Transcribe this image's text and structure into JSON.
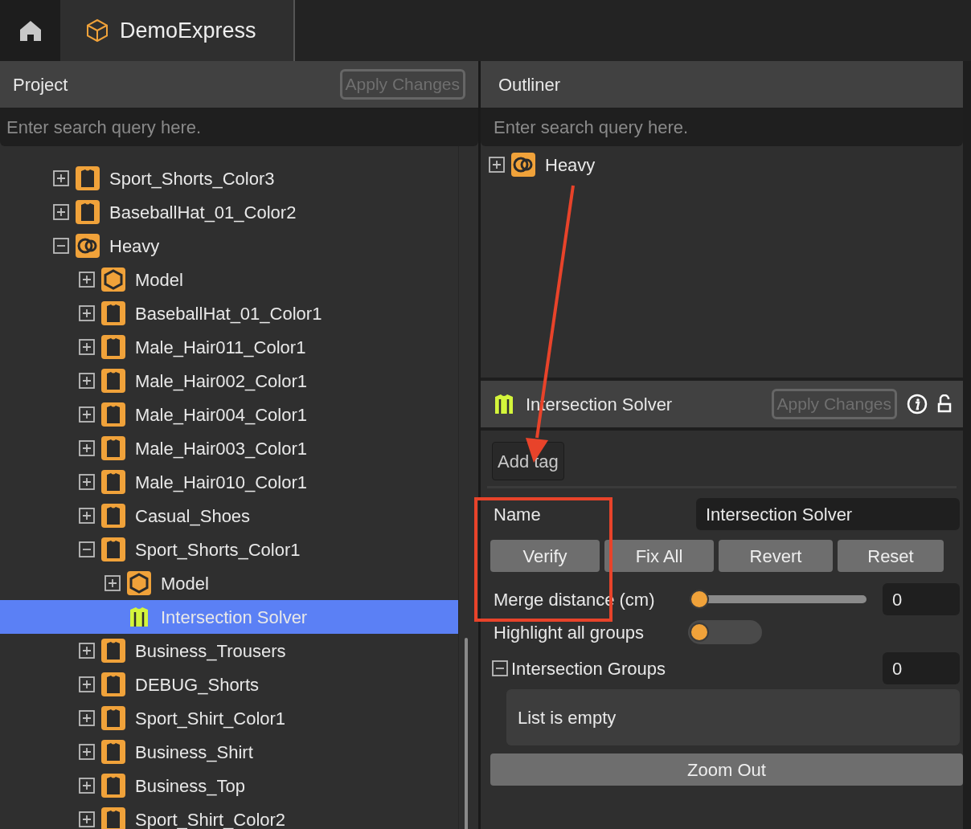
{
  "top_bar": {
    "tab": {
      "label": "DemoExpress",
      "selected": true
    }
  },
  "project": {
    "title": "Project",
    "apply_button": {
      "label": "Apply Changes",
      "disabled": true
    },
    "search": {
      "placeholder": "Enter search query here."
    },
    "tree": [
      {
        "label": "Sport_Shorts_Color3",
        "kind": "garment",
        "expanded": false,
        "selected": false
      },
      {
        "label": "BaseballHat_01_Color2",
        "kind": "garment",
        "expanded": false,
        "selected": false
      },
      {
        "label": "Heavy",
        "kind": "group",
        "expanded": true,
        "selected": false,
        "children": [
          {
            "label": "Model",
            "kind": "model",
            "expanded": false,
            "selected": false
          },
          {
            "label": "BaseballHat_01_Color1",
            "kind": "garment",
            "expanded": false,
            "selected": false
          },
          {
            "label": "Male_Hair011_Color1",
            "kind": "garment",
            "expanded": false,
            "selected": false
          },
          {
            "label": "Male_Hair002_Color1",
            "kind": "garment",
            "expanded": false,
            "selected": false
          },
          {
            "label": "Male_Hair004_Color1",
            "kind": "garment",
            "expanded": false,
            "selected": false
          },
          {
            "label": "Male_Hair003_Color1",
            "kind": "garment",
            "expanded": false,
            "selected": false
          },
          {
            "label": "Male_Hair010_Color1",
            "kind": "garment",
            "expanded": false,
            "selected": false
          },
          {
            "label": "Casual_Shoes",
            "kind": "garment",
            "expanded": false,
            "selected": false
          },
          {
            "label": "Sport_Shorts_Color1",
            "kind": "garment",
            "expanded": true,
            "selected": false,
            "children": [
              {
                "label": "Model",
                "kind": "model",
                "expanded": false,
                "selected": false
              },
              {
                "label": "Intersection Solver",
                "kind": "solver",
                "selected": true
              }
            ]
          },
          {
            "label": "Business_Trousers",
            "kind": "garment",
            "expanded": false,
            "selected": false
          },
          {
            "label": "DEBUG_Shorts",
            "kind": "garment",
            "expanded": false,
            "selected": false
          },
          {
            "label": "Sport_Shirt_Color1",
            "kind": "garment",
            "expanded": false,
            "selected": false
          },
          {
            "label": "Business_Shirt",
            "kind": "garment",
            "expanded": false,
            "selected": false
          },
          {
            "label": "Business_Top",
            "kind": "garment",
            "expanded": false,
            "selected": false
          },
          {
            "label": "Sport_Shirt_Color2",
            "kind": "garment",
            "expanded": false,
            "selected": false
          }
        ]
      }
    ]
  },
  "outliner": {
    "title": "Outliner",
    "search": {
      "placeholder": "Enter search query here."
    },
    "tree": [
      {
        "label": "Heavy",
        "kind": "group",
        "expanded": false,
        "selected": false
      }
    ]
  },
  "inspector": {
    "title": "Intersection Solver",
    "apply_button": {
      "label": "Apply Changes",
      "disabled": true
    },
    "add_tag": "Add tag",
    "name_label": "Name",
    "name_value": "Intersection Solver",
    "actions": [
      "Verify",
      "Fix All",
      "Revert",
      "Reset"
    ],
    "merge_distance": {
      "label": "Merge distance (cm)",
      "level": 0,
      "value": "0"
    },
    "highlight": {
      "label": "Highlight all groups",
      "on": false
    },
    "groups": {
      "label": "Intersection Groups",
      "expanded": true,
      "count": "0",
      "empty_text": "List is empty"
    },
    "zoom_out": "Zoom Out"
  }
}
